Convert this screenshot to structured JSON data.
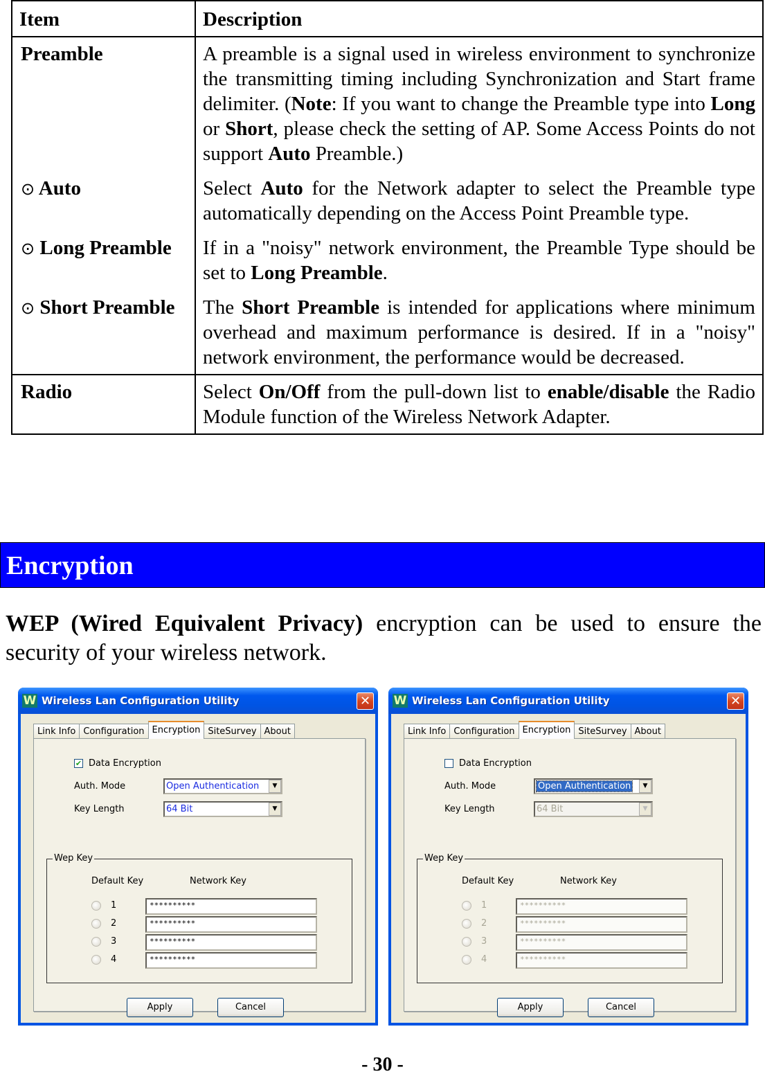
{
  "table": {
    "headers": [
      "Item",
      "Description"
    ],
    "rows": [
      {
        "item": "Preamble",
        "desc_html": "A preamble is a signal used in wireless environment to synchronize the transmitting timing including Synchronization and Start frame delimiter. (<b>Note</b>: If you want to change the Preamble type into <b>Long</b> or <b>Short</b>, please check the setting of AP. Some Access Points do not support <b>Auto</b> Preamble.)"
      },
      {
        "radio_symbol": "⊙",
        "item": "Auto",
        "desc_html": "Select <b>Auto</b> for the Network adapter to select the Preamble type automatically depending on the Access Point Preamble type."
      },
      {
        "radio_symbol": "⊙",
        "item": "Long Preamble",
        "desc_html": "If in a \"noisy\" network environment, the Preamble Type should be set to <b>Long Preamble</b>."
      },
      {
        "radio_symbol": "⊙",
        "item": "Short Preamble",
        "desc_html": "The <b>Short Preamble</b> is intended for applications where minimum overhead and maximum performance is desired. If in a \"noisy\" network environment, the performance would be decreased."
      },
      {
        "item": "Radio",
        "desc_html": "Select <b>On/Off</b> from the pull-down list to <b>enable/disable</b> the Radio Module function of the Wireless Network Adapter."
      }
    ]
  },
  "section": {
    "title": "Encryption",
    "header_color": "#0000ff",
    "intro_bold": "WEP (Wired Equivalent Privacy)",
    "intro_rest": " encryption can be used to ensure the security of your wireless network."
  },
  "windows": [
    {
      "title": "Wireless Lan Configuration Utility",
      "logo": "W",
      "close_glyph": "✕",
      "tabs": [
        "Link Info",
        "Configuration",
        "Encryption",
        "SiteSurvey",
        "About"
      ],
      "active_tab": "Encryption",
      "data_encryption_label": "Data Encryption",
      "data_encryption_checked": true,
      "check_glyph": "✔",
      "auth_mode_label": "Auth. Mode",
      "auth_mode_value": "Open Authentication",
      "key_length_label": "Key Length",
      "key_length_value": "64 Bit",
      "wep_key_group_label": "Wep  Key",
      "default_key_label": "Default Key",
      "network_key_label": "Network Key",
      "keys": [
        {
          "num": "1",
          "value": "**********"
        },
        {
          "num": "2",
          "value": "**********"
        },
        {
          "num": "3",
          "value": "**********"
        },
        {
          "num": "4",
          "value": "**********"
        }
      ],
      "apply_label": "Apply",
      "cancel_label": "Cancel",
      "arrow_glyph": "▼"
    },
    {
      "title": "Wireless Lan Configuration Utility",
      "logo": "W",
      "close_glyph": "✕",
      "tabs": [
        "Link Info",
        "Configuration",
        "Encryption",
        "SiteSurvey",
        "About"
      ],
      "active_tab": "Encryption",
      "data_encryption_label": "Data Encryption",
      "data_encryption_checked": false,
      "check_glyph": "",
      "auth_mode_label": "Auth. Mode",
      "auth_mode_value": "Open Authentication",
      "key_length_label": "Key Length",
      "key_length_value": "64 Bit",
      "wep_key_group_label": "Wep  Key",
      "default_key_label": "Default Key",
      "network_key_label": "Network Key",
      "keys": [
        {
          "num": "1",
          "value": "**********"
        },
        {
          "num": "2",
          "value": "**********"
        },
        {
          "num": "3",
          "value": "**********"
        },
        {
          "num": "4",
          "value": "**********"
        }
      ],
      "apply_label": "Apply",
      "cancel_label": "Cancel",
      "arrow_glyph": "▼"
    }
  ],
  "footer": {
    "page_number": "- 30 -"
  }
}
